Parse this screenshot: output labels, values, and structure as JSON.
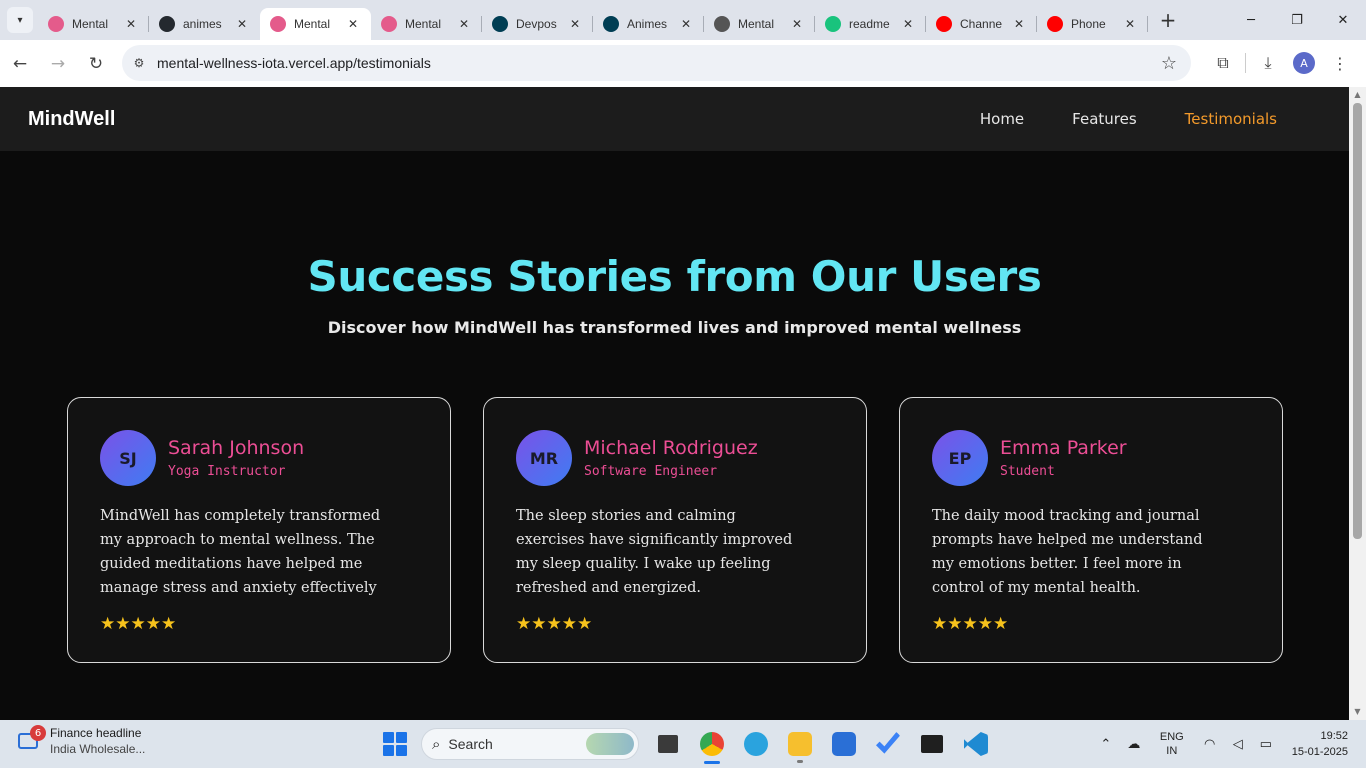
{
  "browser": {
    "tabs": [
      {
        "title": "Mental",
        "favicon": "lotus-icon",
        "color": "#e45b8b",
        "active": false
      },
      {
        "title": "animes",
        "favicon": "github-icon",
        "color": "#24292f",
        "active": false
      },
      {
        "title": "Mental",
        "favicon": "lotus-icon",
        "color": "#e45b8b",
        "active": true
      },
      {
        "title": "Mental",
        "favicon": "lotus-icon",
        "color": "#e45b8b",
        "active": false
      },
      {
        "title": "Devpos",
        "favicon": "devpost-icon",
        "color": "#003e54",
        "active": false
      },
      {
        "title": "Animes",
        "favicon": "devpost-icon",
        "color": "#003e54",
        "active": false
      },
      {
        "title": "Mental",
        "favicon": "openai-icon",
        "color": "#555555",
        "active": false
      },
      {
        "title": "readme",
        "favicon": "readme-icon",
        "color": "#19c37d",
        "active": false
      },
      {
        "title": "Channe",
        "favicon": "youtube-icon",
        "color": "#ff0000",
        "active": false
      },
      {
        "title": "Phone",
        "favicon": "youtube-icon",
        "color": "#ff0000",
        "active": false
      }
    ],
    "url": "mental-wellness-iota.vercel.app/testimonials",
    "profile_initial": "A"
  },
  "site": {
    "brand": "MindWell",
    "nav": [
      {
        "label": "Home",
        "active": false
      },
      {
        "label": "Features",
        "active": false
      },
      {
        "label": "Testimonials",
        "active": true
      }
    ],
    "heading": "Success Stories from Our Users",
    "subheading": "Discover how MindWell has transformed lives and improved mental wellness",
    "testimonials": [
      {
        "initials": "SJ",
        "name": "Sarah Johnson",
        "role": "Yoga Instructor",
        "quote": "MindWell has completely transformed my approach to mental wellness. The guided meditations have helped me manage stress and anxiety effectively",
        "rating": 5
      },
      {
        "initials": "MR",
        "name": "Michael Rodriguez",
        "role": "Software Engineer",
        "quote": "The sleep stories and calming exercises have significantly improved my sleep quality. I wake up feeling refreshed and energized.",
        "rating": 5
      },
      {
        "initials": "EP",
        "name": "Emma Parker",
        "role": "Student",
        "quote": "The daily mood tracking and journal prompts have helped me understand my emotions better. I feel more in control of my mental health.",
        "rating": 5
      }
    ],
    "colors": {
      "accent_heading": "#62e6f3",
      "accent_name": "#ec4e95",
      "nav_active": "#f39a2b",
      "star": "#f6c21c"
    }
  },
  "taskbar": {
    "widget_badge": "6",
    "widget_title": "Finance headline",
    "widget_subtitle": "India Wholesale...",
    "search_label": "Search",
    "lang_line1": "ENG",
    "lang_line2": "IN",
    "time": "19:52",
    "date": "15-01-2025"
  }
}
